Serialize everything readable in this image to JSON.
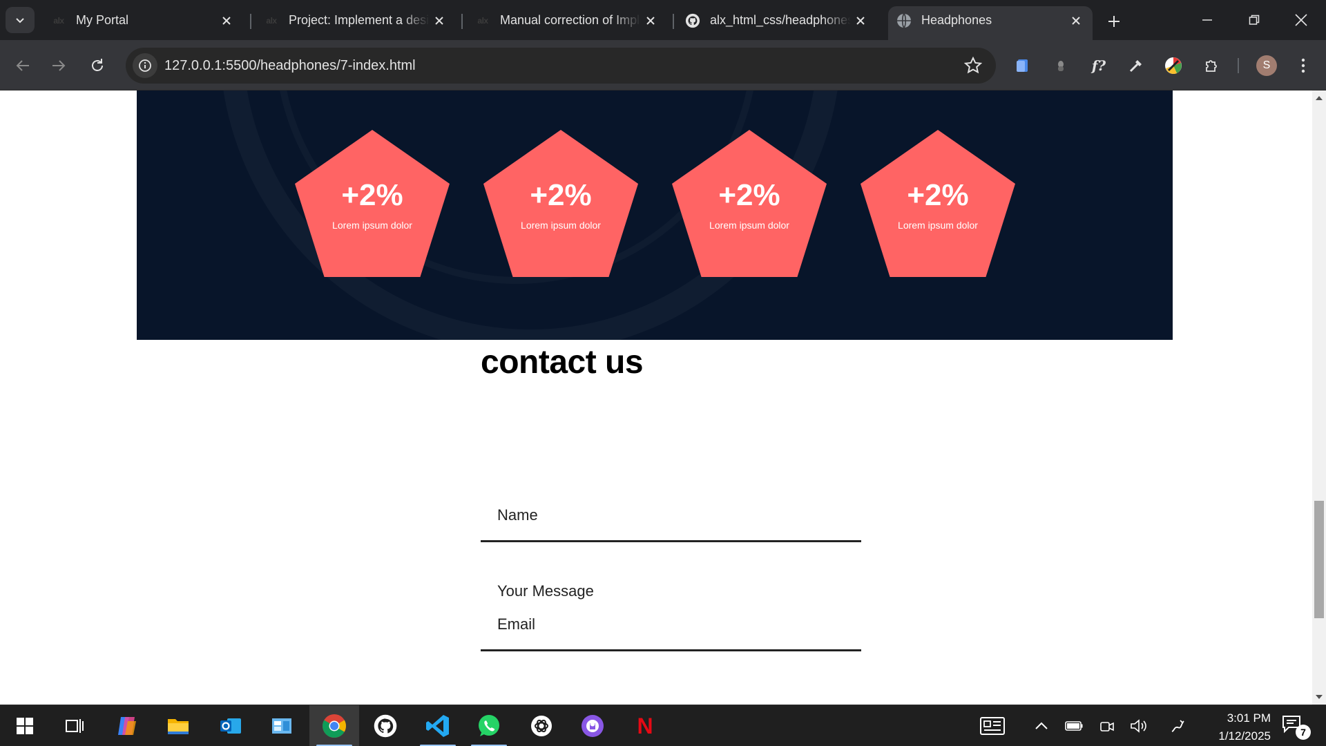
{
  "browser": {
    "tabs": [
      {
        "title": "My Portal",
        "favicon": "alx-logo-icon",
        "active": false
      },
      {
        "title": "Project: Implement a design",
        "favicon": "alx-logo-icon",
        "active": false
      },
      {
        "title": "Manual correction of Imple",
        "favicon": "alx-logo-icon",
        "active": false
      },
      {
        "title": "alx_html_css/headphones",
        "favicon": "github-icon",
        "active": false
      },
      {
        "title": "Headphones",
        "favicon": "globe-icon",
        "active": true
      }
    ],
    "url": "127.0.0.1:5500/headphones/7-index.html",
    "profile_initial": "S",
    "favicon_text": "alx"
  },
  "page": {
    "stats": [
      {
        "value": "+2%",
        "label": "Lorem ipsum dolor"
      },
      {
        "value": "+2%",
        "label": "Lorem ipsum dolor"
      },
      {
        "value": "+2%",
        "label": "Lorem ipsum dolor"
      },
      {
        "value": "+2%",
        "label": "Lorem ipsum dolor"
      }
    ],
    "contact": {
      "title": "contact us",
      "name_placeholder": "Name",
      "email_placeholder": "Email",
      "message_placeholder": "Your Message"
    },
    "colors": {
      "stats_bg": "#08152a",
      "pentagon": "#ff6464"
    }
  },
  "taskbar": {
    "apps": [
      "windows-start-icon",
      "task-view-icon",
      "copilot-icon",
      "file-explorer-icon",
      "outlook-icon",
      "control-panel-icon",
      "chrome-icon",
      "github-desktop-icon",
      "vscode-icon",
      "whatsapp-icon",
      "chatgpt-icon",
      "github-icon",
      "netflix-icon"
    ],
    "time": "3:01 PM",
    "date": "1/12/2025",
    "notification_count": "7",
    "netflix_letter": "N"
  }
}
